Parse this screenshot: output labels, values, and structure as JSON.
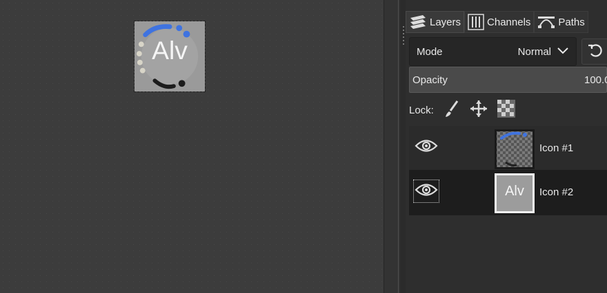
{
  "canvas": {
    "image_text": "Alv"
  },
  "tabs": [
    {
      "label": "Layers",
      "icon": "layers-icon"
    },
    {
      "label": "Channels",
      "icon": "channels-icon"
    },
    {
      "label": "Paths",
      "icon": "paths-icon"
    }
  ],
  "mode": {
    "label": "Mode",
    "value": "Normal"
  },
  "opacity": {
    "label": "Opacity",
    "value": "100.0"
  },
  "lock": {
    "label": "Lock:"
  },
  "layers": [
    {
      "name": "Icon #1",
      "visible": true
    },
    {
      "name": "Icon #2",
      "visible": true,
      "thumb_text": "Alv"
    }
  ],
  "colors": {
    "accent_blue": "#3f73e0",
    "canvas_bg": "#3c3c3c",
    "panel_bg": "#2e2e2e"
  }
}
